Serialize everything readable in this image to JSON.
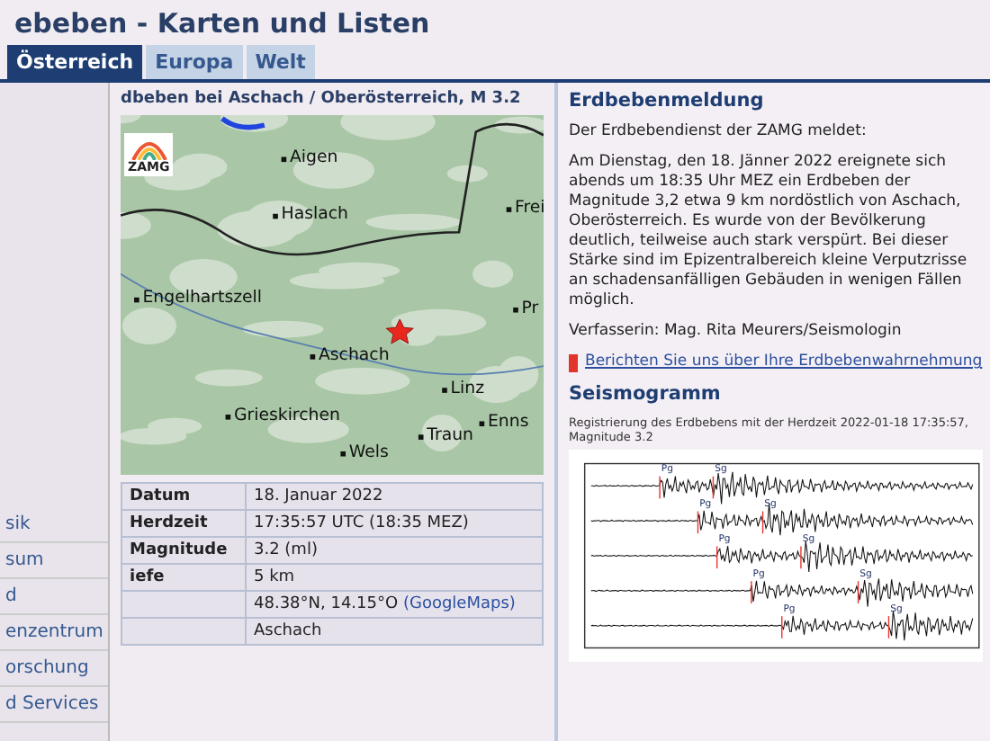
{
  "page": {
    "title": "ebeben - Karten und Listen"
  },
  "tabs": [
    {
      "label": "Österreich",
      "selected": true
    },
    {
      "label": "Europa",
      "selected": false
    },
    {
      "label": "Welt",
      "selected": false
    }
  ],
  "heading": "dbeben bei Aschach / Oberösterreich, M 3.2",
  "sidebar": {
    "items": [
      "sik",
      "sum",
      "d",
      "enzentrum",
      "orschung",
      "d Services"
    ]
  },
  "map": {
    "logo": "ZAMG",
    "places": [
      "Aigen",
      "Haslach",
      "Frei",
      "Engelhartszell",
      "Aschach",
      "Pr",
      "Linz",
      "Enns",
      "Traun",
      "Grieskirchen",
      "Wels"
    ]
  },
  "details": {
    "rows": [
      {
        "label": "Datum",
        "value": "18. Januar 2022"
      },
      {
        "label": "Herdzeit",
        "value": "17:35:57 UTC (18:35 MEZ)"
      },
      {
        "label": "Magnitude",
        "value": "3.2 (ml)"
      },
      {
        "label": "iefe",
        "value": "5 km"
      },
      {
        "value": "48.38°N, 14.15°O",
        "link": "(GoogleMaps)"
      },
      {
        "value": "Aschach"
      }
    ]
  },
  "report": {
    "title": "Erdbebenmeldung",
    "intro": "Der Erdbebendienst der ZAMG meldet:",
    "body": "Am Dienstag, den 18. Jänner 2022 ereignete sich abends um 18:35 Uhr MEZ ein Erdbeben der Magnitude 3,2 etwa 9 km nordöstlich von Aschach, Oberösterreich. Es wurde von der Bevölkerung deutlich, teilweise auch stark verspürt. Bei dieser Stärke sind im Epizentralbereich kleine Verputzrisse an schadensanfälligen Gebäuden in wenigen Fällen möglich.",
    "author": "Verfasserin: Mag. Rita Meurers/Seismologin",
    "link": "Berichten Sie uns über Ihre Erdbebenwahrnehmung"
  },
  "seismogram": {
    "title": "Seismogramm",
    "caption": "Registrierung des Erdbebens mit der Herdzeit 2022-01-18 17:35:57, Magnitude 3.2",
    "traces": [
      {
        "p": "Pg",
        "s": "Sg"
      },
      {
        "p": "Pg",
        "s": "Sg"
      },
      {
        "p": "Pg",
        "s": "Sg"
      },
      {
        "p": "Pg",
        "s": "Sg"
      },
      {
        "p": "Pg",
        "s": "Sg"
      }
    ]
  }
}
